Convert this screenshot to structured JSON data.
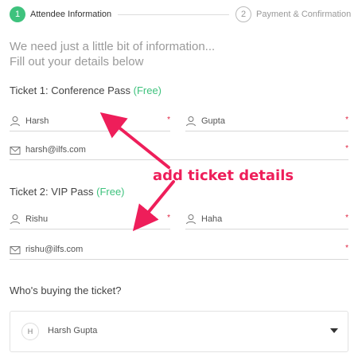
{
  "steps": [
    {
      "number": "1",
      "label": "Attendee Information"
    },
    {
      "number": "2",
      "label": "Payment & Confirmation"
    }
  ],
  "intro": {
    "line1": "We need just a little bit of information...",
    "line2": "Fill out your details below"
  },
  "tickets": [
    {
      "title": "Ticket 1: Conference Pass",
      "price": "(Free)",
      "first_name": "Harsh",
      "last_name": "Gupta",
      "email": "harsh@ilfs.com"
    },
    {
      "title": "Ticket 2: VIP Pass",
      "price": "(Free)",
      "first_name": "Rishu",
      "last_name": "Haha",
      "email": "rishu@ilfs.com"
    }
  ],
  "required_mark": "*",
  "annotation": "add ticket details",
  "buyer": {
    "question": "Who's buying the ticket?",
    "avatar_initial": "H",
    "selected": "Harsh Gupta"
  },
  "colors": {
    "accent_green": "#3ec27d",
    "annotation_pink": "#ee1e5a"
  },
  "icons": {
    "person": "person-icon",
    "email": "envelope-icon",
    "dropdown": "caret-down-icon"
  }
}
